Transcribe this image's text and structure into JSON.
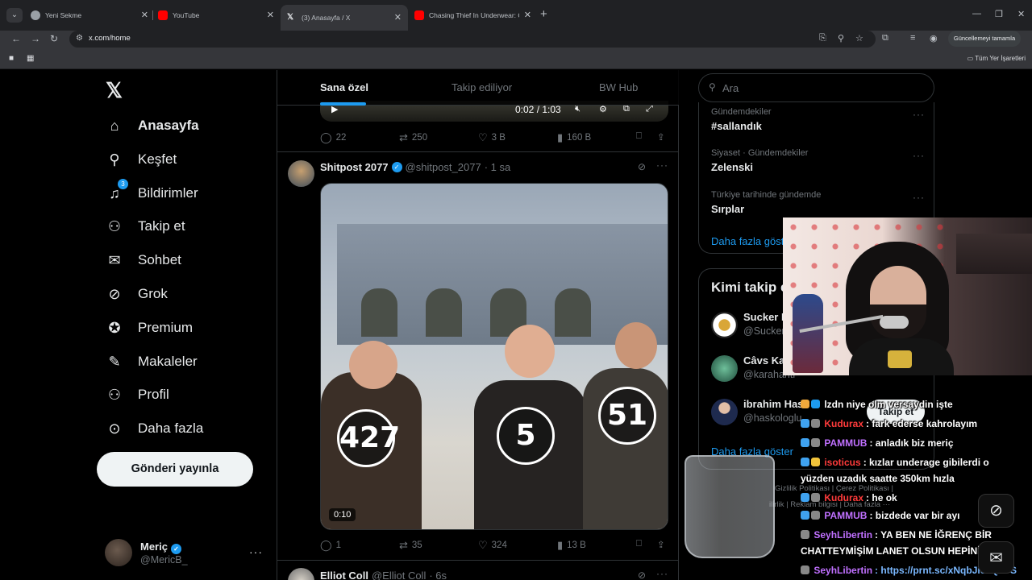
{
  "browser": {
    "tabs": [
      {
        "title": "Yeni Sekme",
        "favicon_color": "#9aa0a6"
      },
      {
        "title": "YouTube",
        "favicon_color": "#ff0000"
      },
      {
        "title": "(3) Anasayfa / X",
        "favicon_color": "#e8eaed"
      },
      {
        "title": "Chasing Thief In Underwear: Ca",
        "favicon_color": "#ff0000"
      }
    ],
    "url": "x.com/home",
    "update_button": "Güncellemeyi tamamla",
    "bookmarks_all": "Tüm Yer İşaretleri"
  },
  "x": {
    "nav": [
      {
        "label": "Anasayfa",
        "icon": "home-icon",
        "glyph": "⌂"
      },
      {
        "label": "Keşfet",
        "icon": "search-icon",
        "glyph": "⚲"
      },
      {
        "label": "Bildirimler",
        "icon": "bell-icon",
        "glyph": "🔔︎",
        "badge": "3"
      },
      {
        "label": "Takip et",
        "icon": "person-plus-icon",
        "glyph": "⚇"
      },
      {
        "label": "Sohbet",
        "icon": "mail-icon",
        "glyph": "✉"
      },
      {
        "label": "Grok",
        "icon": "grok-icon",
        "glyph": "⊘"
      },
      {
        "label": "Premium",
        "icon": "premium-icon",
        "glyph": "✪"
      },
      {
        "label": "Makaleler",
        "icon": "article-icon",
        "glyph": "✎"
      },
      {
        "label": "Profil",
        "icon": "profile-icon",
        "glyph": "⚲"
      },
      {
        "label": "Daha fazla",
        "icon": "more-circle-icon",
        "glyph": "⊙"
      }
    ],
    "post_button": "Gönderi yayınla",
    "profile": {
      "name": "Meriç",
      "handle": "@MericB_"
    },
    "timeline_tabs": [
      "Sana özel",
      "Takip ediliyor",
      "BW Hub"
    ],
    "video_time": "0:02 / 1:03",
    "tweet1_actions": {
      "replies": "22",
      "retweets": "250",
      "likes": "3 B",
      "views": "160 B"
    },
    "tweet2": {
      "name": "Shitpost 2077",
      "handle": "@shitpost_2077",
      "time": "· 1 sa",
      "badges": [
        "427",
        "5",
        "51"
      ],
      "duration": "0:10",
      "actions": {
        "replies": "1",
        "retweets": "35",
        "likes": "324",
        "views": "13 B"
      }
    },
    "tweet3": {
      "name": "Elliot Coll",
      "handle": "@Elliot Coll",
      "time": "· 6s"
    },
    "search_placeholder": "Ara",
    "trends": [
      {
        "meta": "Gündemdekiler",
        "name": "#sallandık"
      },
      {
        "meta": "Siyaset · Gündemdekiler",
        "name": "Zelenski"
      },
      {
        "meta": "Türkiye tarihinde gündemde",
        "name": "Sırplar"
      }
    ],
    "show_more": "Daha fazla göster",
    "who_to_follow_title": "Kimi takip e",
    "suggestions": [
      {
        "name": "Sucker P",
        "handle": "@Sucker"
      },
      {
        "name": "Câvs Kar",
        "handle": "@karahanti"
      },
      {
        "name": "ibrahim Has",
        "handle": "@haskologlu"
      }
    ],
    "follow_button": "Takip et",
    "show_more_2": "Daha fazla göster",
    "footer_line1": "Gizlilik Politikası | Çerez Politikası |",
    "footer_line2": "ilirlik | Reklam bilgisi | Daha fazla ···"
  },
  "chat": [
    {
      "user": "",
      "user_color": "#ffffff",
      "text": "lzdn niye olm versaydin işte"
    },
    {
      "user": "Kudurax",
      "user_color": "#ff3b3b",
      "text": ": fark ederse kahrolayım"
    },
    {
      "user": "PAMMUB",
      "user_color": "#c070ff",
      "text": ": anladık biz meriç"
    },
    {
      "user": "isoticus",
      "user_color": "#ff3b3b",
      "text": ": kızlar underage gibilerdi o yüzden uzadık saatte 350km hızla"
    },
    {
      "user": "Kudurax",
      "user_color": "#ff3b3b",
      "text": ": he ok"
    },
    {
      "user": "PAMMUB",
      "user_color": "#c070ff",
      "text": ": bizdede var bir ayı"
    },
    {
      "user": "SeyhLibertin",
      "user_color": "#c070ff",
      "text": ": YA BEN NE İĞRENÇ BİR CHATTEYMİŞİM LANET OLSUN HEPİNİZE"
    },
    {
      "user": "SeyhLibertin",
      "user_color": "#c070ff",
      "text": ": https://prnt.sc/xNqbJie7QuFS"
    }
  ]
}
